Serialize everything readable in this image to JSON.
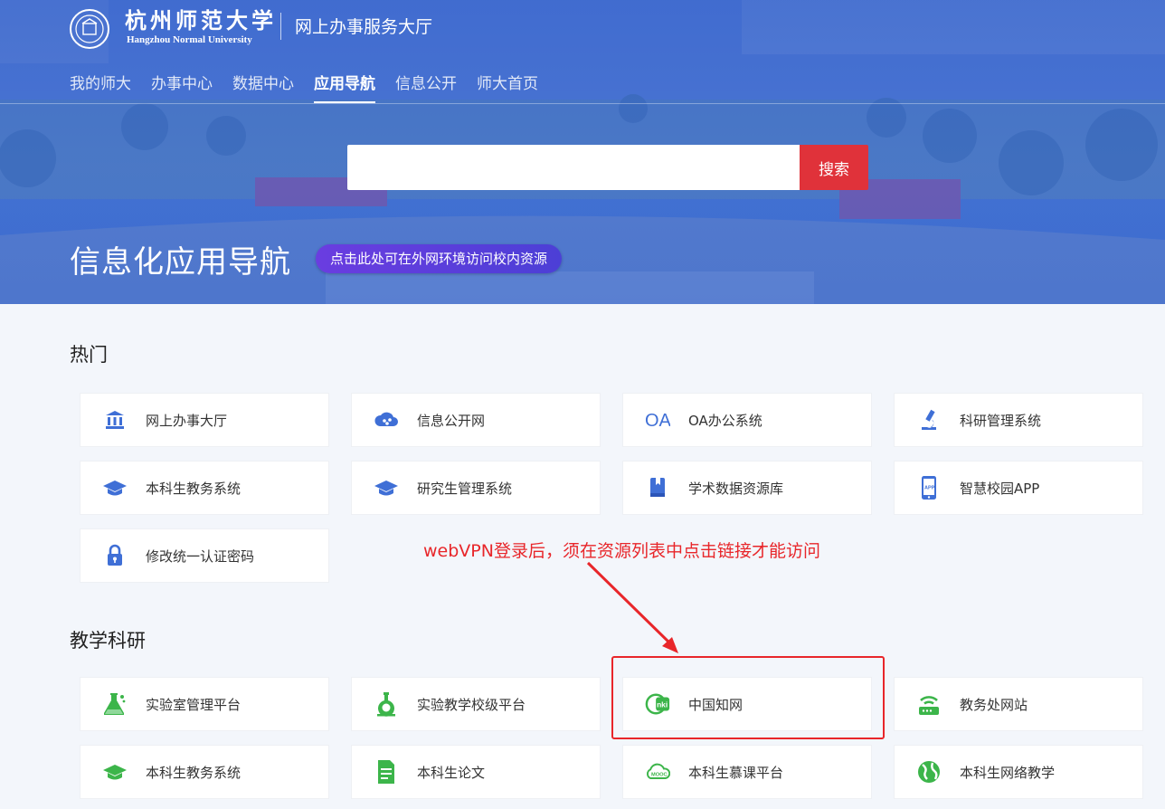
{
  "header": {
    "school_name_cn": "杭州师范大学",
    "school_name_en": "Hangzhou Normal University",
    "site_title": "网上办事服务大厅"
  },
  "nav": {
    "items": [
      {
        "label": "我的师大",
        "active": false
      },
      {
        "label": "办事中心",
        "active": false
      },
      {
        "label": "数据中心",
        "active": false
      },
      {
        "label": "应用导航",
        "active": true
      },
      {
        "label": "信息公开",
        "active": false
      },
      {
        "label": "师大首页",
        "active": false
      }
    ]
  },
  "search": {
    "placeholder": "",
    "button_label": "搜索"
  },
  "hero": {
    "title": "信息化应用导航",
    "vpn_link": "点击此处可在外网环境访问校内资源"
  },
  "sections": {
    "hot": {
      "title": "热门",
      "items": [
        {
          "label": "网上办事大厅",
          "icon": "bank-icon"
        },
        {
          "label": "信息公开网",
          "icon": "cloud-icon"
        },
        {
          "label": "OA办公系统",
          "icon": "oa-icon"
        },
        {
          "label": "科研管理系统",
          "icon": "microscope-icon"
        },
        {
          "label": "本科生教务系统",
          "icon": "graduation-cap-icon"
        },
        {
          "label": "研究生管理系统",
          "icon": "graduation-cap-icon"
        },
        {
          "label": "学术数据资源库",
          "icon": "book-icon"
        },
        {
          "label": "智慧校园APP",
          "icon": "phone-app-icon"
        },
        {
          "label": "修改统一认证密码",
          "icon": "lock-icon"
        }
      ]
    },
    "teaching": {
      "title": "教学科研",
      "items": [
        {
          "label": "实验室管理平台",
          "icon": "flask-icon"
        },
        {
          "label": "实验教学校级平台",
          "icon": "lab-flask-icon"
        },
        {
          "label": "中国知网",
          "icon": "cnki-icon"
        },
        {
          "label": "教务处网站",
          "icon": "wifi-router-icon"
        },
        {
          "label": "本科生教务系统",
          "icon": "graduation-cap-icon"
        },
        {
          "label": "本科生论文",
          "icon": "document-icon"
        },
        {
          "label": "本科生慕课平台",
          "icon": "mooc-icon"
        },
        {
          "label": "本科生网络教学",
          "icon": "globe-icon"
        }
      ]
    }
  },
  "annotation": {
    "text": "webVPN登录后，须在资源列表中点击链接才能访问"
  },
  "colors": {
    "primary_blue": "#3f6fd6",
    "icon_green": "#3cb54a",
    "search_red": "#e0323a",
    "annotation_red": "#e8262a",
    "vpn_purple": "#5a3ddc"
  }
}
